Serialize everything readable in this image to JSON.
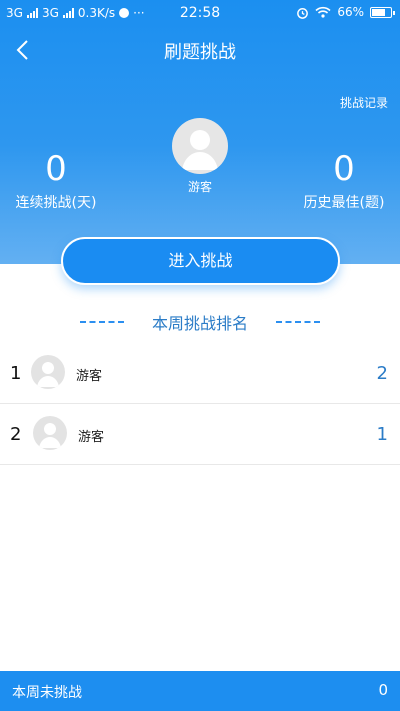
{
  "status_bar": {
    "network1": "3G",
    "network2": "3G",
    "speed": "0.3K/s",
    "more": "···",
    "time": "22:58",
    "battery": "66%",
    "battery_level": 0.66
  },
  "nav": {
    "title": "刷题挑战",
    "back_icon": "chevron-left-icon"
  },
  "record_link": "挑战记录",
  "profile": {
    "name": "游客",
    "avatar_icon": "user-avatar-icon"
  },
  "stats": {
    "streak_value": "0",
    "streak_label": "连续挑战(天)",
    "best_value": "0",
    "best_label": "历史最佳(题)"
  },
  "enter_button": "进入挑战",
  "ranking": {
    "title": "本周挑战排名",
    "rows": [
      {
        "rank": "1",
        "name": "游客",
        "score": "2"
      },
      {
        "rank": "2",
        "name": "游客",
        "score": "1"
      }
    ]
  },
  "footer": {
    "text": "本周未挑战",
    "value": "0"
  },
  "colors": {
    "primary": "#1d8ef0",
    "accent_text": "#2b7cc7"
  }
}
